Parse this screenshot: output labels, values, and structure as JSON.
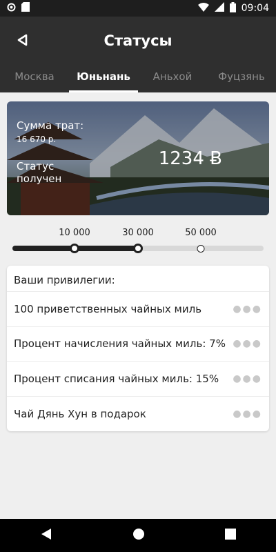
{
  "status_bar": {
    "time": "09:04"
  },
  "app_bar": {
    "title": "Статусы"
  },
  "tabs": [
    {
      "label": "Москва",
      "active": false
    },
    {
      "label": "Юньнань",
      "active": true
    },
    {
      "label": "Аньхой",
      "active": false
    },
    {
      "label": "Фуцзянь",
      "active": false
    }
  ],
  "hero": {
    "spend_label": "Сумма трат:",
    "spend_value": "16 670 р.",
    "status_text": "Статус получен",
    "points": "1234 Ƀ"
  },
  "progress": {
    "ticks": [
      "10 000",
      "30 000",
      "50 000"
    ],
    "filled_fraction": 0.5
  },
  "privileges": {
    "heading": "Ваши привилегии:",
    "items": [
      "100 приветственных чайных миль",
      "Процент начисления чайных миль: 7%",
      "Процент списания чайных миль: 15%",
      "Чай Дянь Хун в подарок"
    ]
  },
  "colors": {
    "app_bar": "#2f2f2f",
    "status_bar": "#1e1e1e",
    "background": "#efefef"
  }
}
